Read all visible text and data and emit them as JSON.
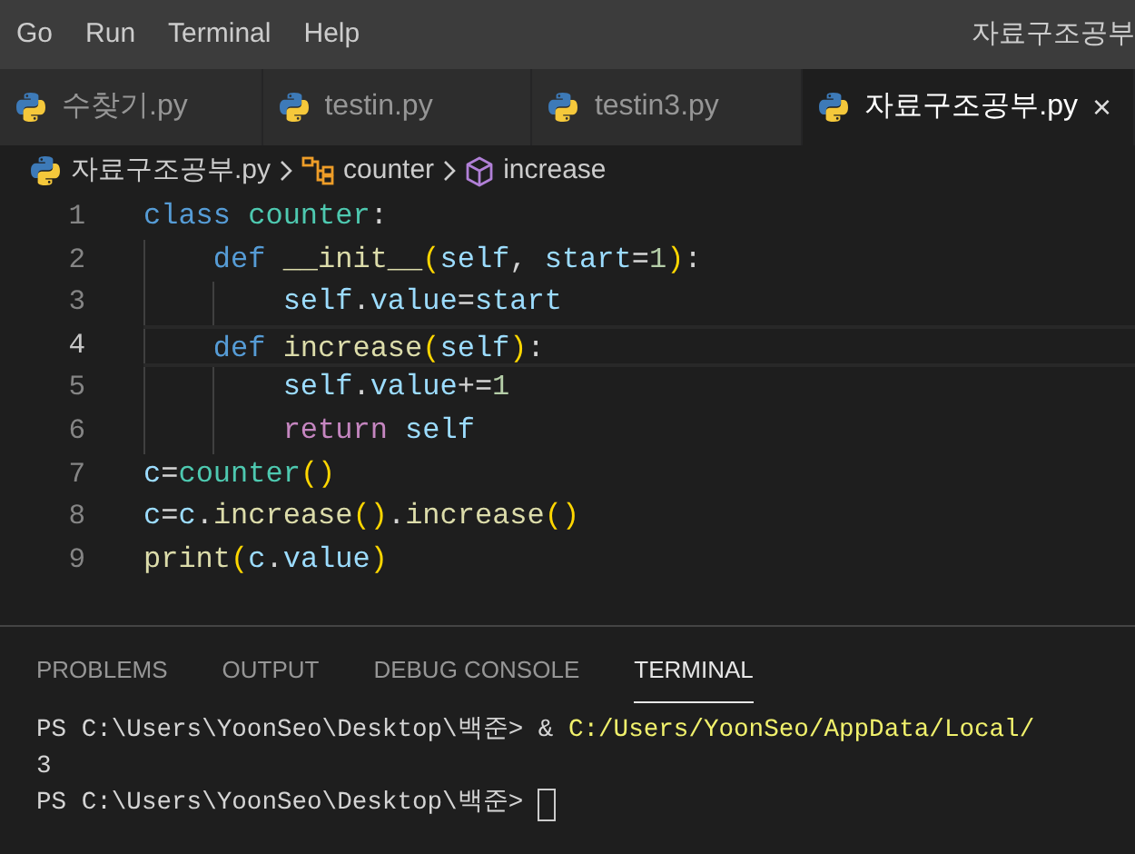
{
  "menu": [
    "Go",
    "Run",
    "Terminal",
    "Help"
  ],
  "window": {
    "title": "자료구조공부"
  },
  "tabs": [
    {
      "label": "수찾기.py",
      "selected": false
    },
    {
      "label": "testin.py",
      "selected": false
    },
    {
      "label": "testin3.py",
      "selected": false
    },
    {
      "label": "자료구조공부.py",
      "selected": true,
      "close": "×"
    }
  ],
  "breadcrumb": [
    {
      "kind": "file",
      "label": "자료구조공부.py"
    },
    {
      "kind": "class",
      "label": "counter"
    },
    {
      "kind": "method",
      "label": "increase"
    }
  ],
  "code_lines": [
    {
      "number": "1",
      "current": false,
      "tokens": [
        {
          "kind": "keyword",
          "text": "class "
        },
        {
          "kind": "type",
          "text": "counter"
        },
        {
          "kind": "plain",
          "text": ":"
        }
      ]
    },
    {
      "number": "2",
      "current": false,
      "tokens": [
        {
          "kind": "keyword",
          "text": "    def "
        },
        {
          "kind": "function",
          "text": "__init__"
        },
        {
          "kind": "bracket",
          "text": "("
        },
        {
          "kind": "variable",
          "text": "self"
        },
        {
          "kind": "plain",
          "text": ", "
        },
        {
          "kind": "variable",
          "text": "start"
        },
        {
          "kind": "plain",
          "text": "="
        },
        {
          "kind": "number",
          "text": "1"
        },
        {
          "kind": "bracket",
          "text": ")"
        },
        {
          "kind": "plain",
          "text": ":"
        }
      ]
    },
    {
      "number": "3",
      "current": false,
      "tokens": [
        {
          "kind": "variable",
          "text": "        self"
        },
        {
          "kind": "plain",
          "text": "."
        },
        {
          "kind": "variable",
          "text": "value"
        },
        {
          "kind": "plain",
          "text": "="
        },
        {
          "kind": "variable",
          "text": "start"
        }
      ]
    },
    {
      "number": "4",
      "current": true,
      "tokens": [
        {
          "kind": "keyword",
          "text": "    def "
        },
        {
          "kind": "function",
          "text": "increase"
        },
        {
          "kind": "bracket",
          "text": "("
        },
        {
          "kind": "variable",
          "text": "self"
        },
        {
          "kind": "bracket",
          "text": ")"
        },
        {
          "kind": "plain",
          "text": ":"
        }
      ]
    },
    {
      "number": "5",
      "current": false,
      "tokens": [
        {
          "kind": "variable",
          "text": "        self"
        },
        {
          "kind": "plain",
          "text": "."
        },
        {
          "kind": "variable",
          "text": "value"
        },
        {
          "kind": "plain",
          "text": "+="
        },
        {
          "kind": "number",
          "text": "1"
        }
      ]
    },
    {
      "number": "6",
      "current": false,
      "tokens": [
        {
          "kind": "control",
          "text": "        return "
        },
        {
          "kind": "variable",
          "text": "self"
        }
      ]
    },
    {
      "number": "7",
      "current": false,
      "tokens": [
        {
          "kind": "variable",
          "text": "c"
        },
        {
          "kind": "plain",
          "text": "="
        },
        {
          "kind": "type",
          "text": "counter"
        },
        {
          "kind": "bracket",
          "text": "()"
        }
      ]
    },
    {
      "number": "8",
      "current": false,
      "tokens": [
        {
          "kind": "variable",
          "text": "c"
        },
        {
          "kind": "plain",
          "text": "="
        },
        {
          "kind": "variable",
          "text": "c"
        },
        {
          "kind": "plain",
          "text": "."
        },
        {
          "kind": "function",
          "text": "increase"
        },
        {
          "kind": "bracket",
          "text": "()"
        },
        {
          "kind": "plain",
          "text": "."
        },
        {
          "kind": "function",
          "text": "increase"
        },
        {
          "kind": "bracket",
          "text": "()"
        }
      ]
    },
    {
      "number": "9",
      "current": false,
      "tokens": [
        {
          "kind": "function",
          "text": "print"
        },
        {
          "kind": "bracket",
          "text": "("
        },
        {
          "kind": "variable",
          "text": "c"
        },
        {
          "kind": "plain",
          "text": "."
        },
        {
          "kind": "variable",
          "text": "value"
        },
        {
          "kind": "bracket",
          "text": ")"
        }
      ]
    }
  ],
  "panel_tabs": [
    {
      "label": "PROBLEMS",
      "selected": false
    },
    {
      "label": "OUTPUT",
      "selected": false
    },
    {
      "label": "DEBUG CONSOLE",
      "selected": false
    },
    {
      "label": "TERMINAL",
      "selected": true
    }
  ],
  "terminal_lines": [
    {
      "segments": [
        {
          "kind": "plain",
          "text": "PS C:\\Users\\YoonSeo\\Desktop\\백준> & "
        },
        {
          "kind": "path",
          "text": "C:/Users/YoonSeo/AppData/Local/"
        }
      ],
      "cursor": false
    },
    {
      "segments": [
        {
          "kind": "plain",
          "text": "3"
        }
      ],
      "cursor": false
    },
    {
      "segments": [
        {
          "kind": "plain",
          "text": "PS C:\\Users\\YoonSeo\\Desktop\\백준> "
        }
      ],
      "cursor": true
    }
  ]
}
